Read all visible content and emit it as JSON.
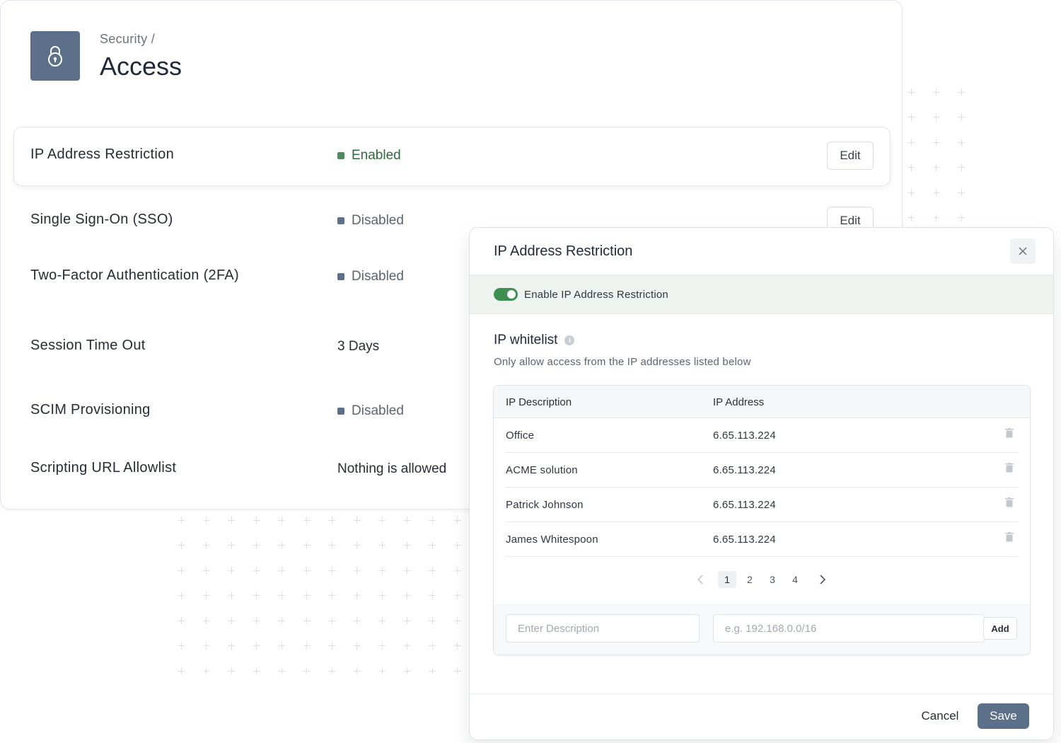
{
  "header": {
    "breadcrumb": "Security /",
    "title": "Access"
  },
  "settings": [
    {
      "label": "IP Address Restriction",
      "status": "Enabled",
      "status_kind": "enabled",
      "edit": "Edit"
    },
    {
      "label": "Single Sign-On (SSO)",
      "status": "Disabled",
      "status_kind": "disabled",
      "edit": "Edit"
    },
    {
      "label": "Two-Factor Authentication (2FA)",
      "status": "Disabled",
      "status_kind": "disabled"
    },
    {
      "label": "Session Time Out",
      "value": "3 Days"
    },
    {
      "label": "SCIM Provisioning",
      "status": "Disabled",
      "status_kind": "disabled"
    },
    {
      "label": "Scripting URL Allowlist",
      "value": "Nothing is allowed"
    }
  ],
  "modal": {
    "title": "IP Address Restriction",
    "toggle_label": "Enable IP Address Restriction",
    "toggle_on": true,
    "section_title": "IP whitelist",
    "section_sub": "Only allow access from the IP addresses listed below",
    "columns": [
      "IP Description",
      "IP Address"
    ],
    "rows": [
      {
        "description": "Office",
        "address": "6.65.113.224"
      },
      {
        "description": "ACME solution",
        "address": "6.65.113.224"
      },
      {
        "description": "Patrick Johnson",
        "address": "6.65.113.224"
      },
      {
        "description": "James Whitespoon",
        "address": "6.65.113.224"
      }
    ],
    "pagination": {
      "pages": [
        "1",
        "2",
        "3",
        "4"
      ],
      "current": "1"
    },
    "description_placeholder": "Enter Description",
    "address_placeholder": "e.g. 192.168.0.0/16",
    "add_label": "Add",
    "cancel_label": "Cancel",
    "save_label": "Save"
  },
  "colors": {
    "accent": "#5d7089",
    "enabled_green": "#4f8a5b",
    "toggle_green": "#3e8e4f"
  },
  "icons": {
    "header": "lock-icon",
    "close": "close-icon",
    "info": "info-icon",
    "row_delete": "trash-icon",
    "prev": "chevron-left-icon",
    "next": "chevron-right-icon"
  }
}
